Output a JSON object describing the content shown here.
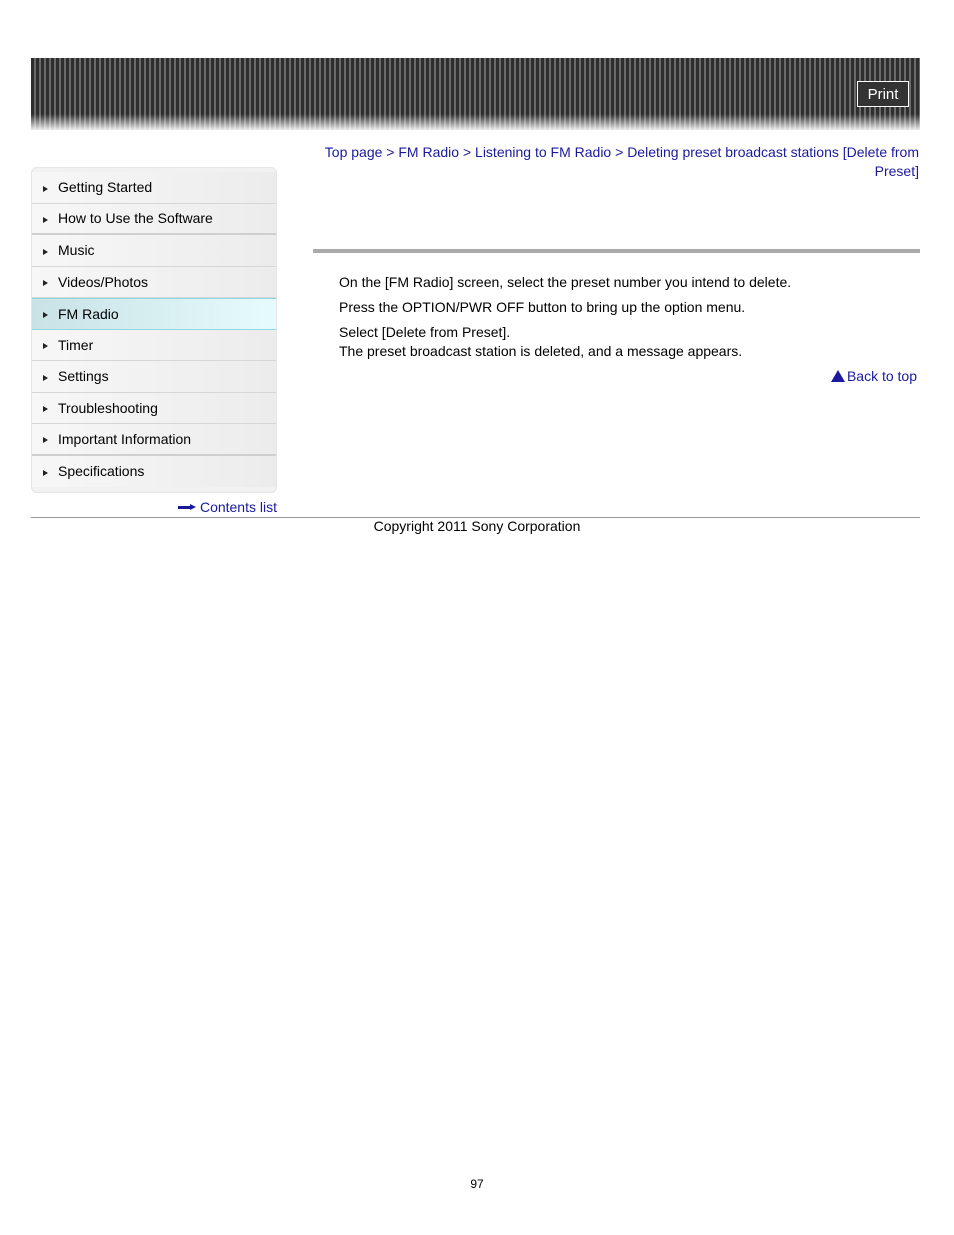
{
  "header": {
    "print_label": "Print"
  },
  "sidebar": {
    "items": [
      {
        "label": "Getting Started",
        "active": false
      },
      {
        "label": "How to Use the Software",
        "active": false
      },
      {
        "label": "Music",
        "active": false
      },
      {
        "label": "Videos/Photos",
        "active": false
      },
      {
        "label": "FM Radio",
        "active": true
      },
      {
        "label": "Timer",
        "active": false
      },
      {
        "label": "Settings",
        "active": false
      },
      {
        "label": "Troubleshooting",
        "active": false
      },
      {
        "label": "Important Information",
        "active": false
      },
      {
        "label": "Specifications",
        "active": false
      }
    ],
    "contents_list_label": "Contents list"
  },
  "breadcrumb": {
    "items": [
      "Top page",
      "FM Radio",
      "Listening to FM Radio",
      "Deleting preset broadcast stations [Delete from Preset]"
    ],
    "separator": " > "
  },
  "main": {
    "steps": [
      "On the [FM Radio] screen, select the preset number you intend to delete.",
      "Press the OPTION/PWR OFF button to bring up the option menu.",
      "Select [Delete from Preset]."
    ],
    "result": "The preset broadcast station is deleted, and a message appears.",
    "back_to_top_label": "Back to top"
  },
  "footer": {
    "copyright": "Copyright 2011 Sony Corporation",
    "page_number": "97"
  },
  "colors": {
    "link": "#1a1a9c",
    "active_nav": "#d9f3f7"
  }
}
